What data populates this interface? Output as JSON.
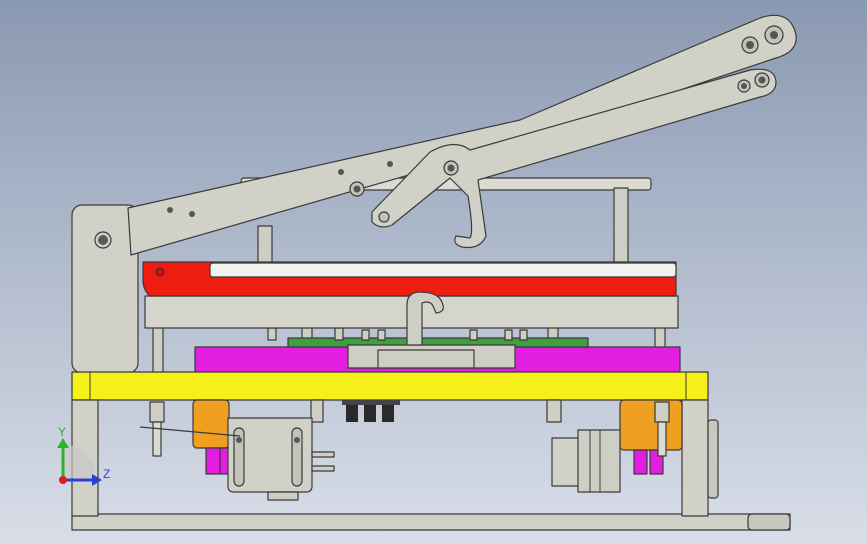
{
  "triad": {
    "y_label": "Y",
    "z_label": "Z",
    "y_color": "#2bb32b",
    "z_color": "#2b3fd6",
    "origin_color": "#d42020"
  },
  "colors": {
    "frame": "#d2d1c8",
    "edge": "#3a3a3a",
    "red_plate": "#ee1d10",
    "yellow_base": "#f5f01a",
    "magenta_block": "#e21ee0",
    "orange_sleeve": "#f0a020",
    "green_pcb": "#3ea03e",
    "dark_connector": "#2a2a2a"
  }
}
